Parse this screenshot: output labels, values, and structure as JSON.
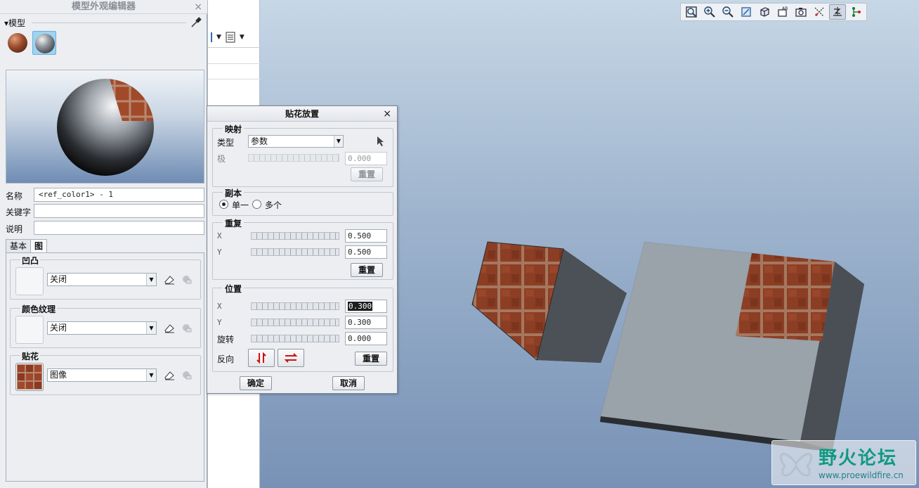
{
  "editor": {
    "title": "模型外观编辑器",
    "close": "×",
    "model_section": "▾模型",
    "name_label": "名称",
    "name_value": "<ref_color1> - 1",
    "keyword_label": "关键字",
    "keyword_value": "",
    "description_label": "说明",
    "description_value": "",
    "tabs": [
      {
        "label": "基本"
      },
      {
        "label": "图"
      }
    ],
    "bump": {
      "title": "凹凸",
      "value": "关闭"
    },
    "color_texture": {
      "title": "颜色纹理",
      "value": "关闭"
    },
    "decal": {
      "title": "贴花",
      "value": "图像"
    }
  },
  "dialog": {
    "title": "贴花放置",
    "close": "×",
    "mapping": {
      "title": "映射",
      "type_label": "类型",
      "type_value": "参数",
      "pole_label": "极",
      "pole_value": "0.000",
      "reset": "重置"
    },
    "copies": {
      "title": "副本",
      "single": "单一",
      "multiple": "多个",
      "selected": "single"
    },
    "repeat": {
      "title": "重复",
      "x_label": "X",
      "x_value": "0.500",
      "y_label": "Y",
      "y_value": "0.500",
      "reset": "重置"
    },
    "position": {
      "title": "位置",
      "x_label": "X",
      "x_value": "0.300",
      "y_label": "Y",
      "y_value": "0.300",
      "rotate_label": "旋转",
      "rotate_value": "0.000",
      "flip_label": "反向",
      "reset": "重置"
    },
    "ok": "确定",
    "cancel": "取消"
  },
  "watermark": {
    "title": "野火论坛",
    "url": "www.proewildfire.cn"
  },
  "colors": {
    "accent": "#9ed3f2",
    "brick": "#8a3f26",
    "body_gray": "#9ba3ab"
  }
}
